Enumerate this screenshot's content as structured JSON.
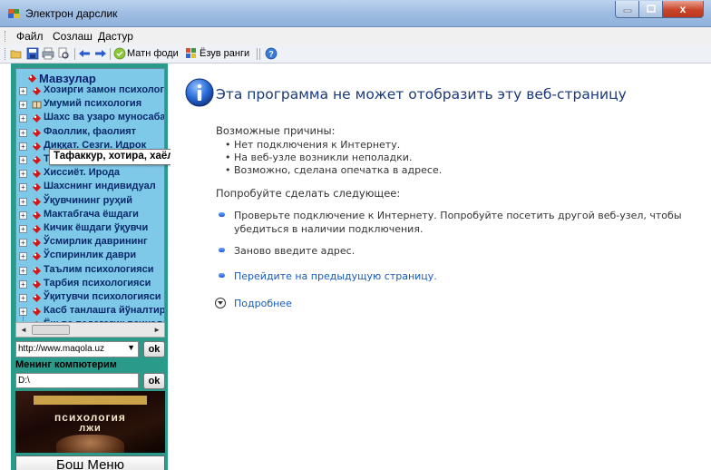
{
  "window": {
    "title": "Электрон дарслик",
    "close_glyph": "x"
  },
  "menu": {
    "items": [
      "Файл",
      "Созлаш",
      "Дастур"
    ]
  },
  "toolbar": {
    "font_label": "Матн фоди",
    "color_label": "Ёзув ранги"
  },
  "tree": {
    "root": "Мавзулар",
    "items": [
      "Хозирги замон психологияси",
      "Умумий психология",
      "Шахс ва узаро муносабатлар",
      "Фаоллик, фаолият",
      "Диққат. Сезги. Идрок",
      "Тафаккур, хотира, хаёл",
      "Хиссиёт. Ирода",
      "Шахснинг индивидуал",
      "Ўқувчининг руҳий",
      "Мактабгача ёшдаги",
      "Кичик ёшдаги ўқувчи",
      "Ўсмирлик даврининг",
      "Ўспиринлик даври",
      "Таълим психологияси",
      "Тарбия психологияси",
      "Ўқитувчи психологияси",
      "Касб танлашга йўналтириш",
      "Ёш ва педагогик психология"
    ],
    "tooltip": "Тафаккур, хотира, хаёл"
  },
  "left": {
    "url_value": "http://www.maqola.uz",
    "ok_label": "ok",
    "my_computer_label": "Менинг компютерим",
    "path_value": "D:\\",
    "book": {
      "title": "психология",
      "subtitle": "лжи"
    },
    "main_menu_button": "Бош Меню"
  },
  "error_page": {
    "title": "Эта программа не может отобразить эту веб-страницу",
    "reasons_title": "Возможные причины:",
    "reasons": [
      "Нет подключения к Интернету.",
      "На веб-узле возникли неполадки.",
      "Возможно, сделана опечатка в адресе."
    ],
    "try_title": "Попробуйте сделать следующее:",
    "try_items": [
      "Проверьте подключение к Интернету. Попробуйте посетить другой веб-узел, чтобы убедиться в наличии подключения.",
      "Заново введите адрес.",
      "Перейдите на предыдущую страницу."
    ],
    "more": "Подробнее"
  }
}
